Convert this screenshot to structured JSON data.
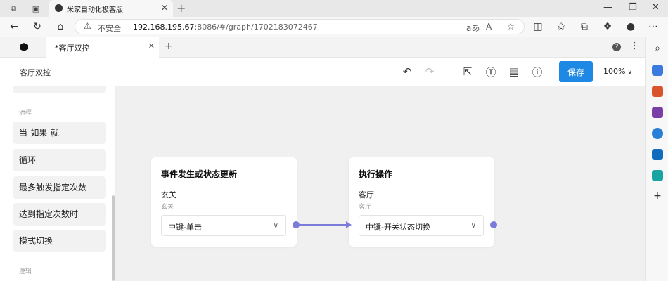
{
  "browser": {
    "tab_title": "米家自动化极客版",
    "address": {
      "insecure_label": "不安全",
      "host": "192.168.195.67",
      "rest": ":8086/#/graph/1702183072467"
    },
    "icons": [
      "workspaces-icon",
      "tab-actions-icon",
      "back-icon",
      "reload-icon",
      "home-icon",
      "read-aloud-icon",
      "favorite-icon",
      "split-screen-icon",
      "collections-icon",
      "extensions-icon",
      "profile-icon",
      "menu-icon"
    ]
  },
  "app": {
    "tab_title": "*客厅双控",
    "graph_name": "客厅双控",
    "save_label": "保存",
    "zoom": "100%"
  },
  "palette": {
    "partial_item": "...",
    "section_flow": "流程",
    "items": [
      "当-如果-就",
      "循环",
      "最多触发指定次数",
      "达到指定次数时",
      "模式切换"
    ],
    "section_logic": "逻辑"
  },
  "nodes": [
    {
      "title": "事件发生或状态更新",
      "device": "玄关",
      "room": "玄关",
      "selection": "中键-单击"
    },
    {
      "title": "执行操作",
      "device": "客厅",
      "room": "客厅",
      "selection": "中键-开关状态切换"
    }
  ],
  "colors": {
    "accent": "#1e88e5",
    "edge": "#7b7bd9",
    "canvas": "#f0f0f0"
  }
}
